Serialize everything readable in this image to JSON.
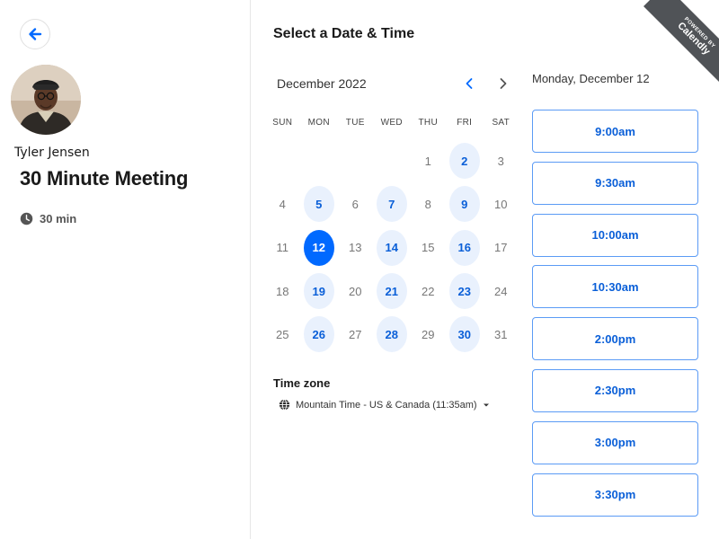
{
  "host": {
    "name": "Tyler Jensen"
  },
  "event": {
    "title": "30 Minute Meeting",
    "duration": "30 min"
  },
  "calendar": {
    "section_title": "Select a Date & Time",
    "month": "December 2022",
    "weekdays": [
      "SUN",
      "MON",
      "TUE",
      "WED",
      "THU",
      "FRI",
      "SAT"
    ],
    "days": [
      {
        "num": "",
        "state": "empty"
      },
      {
        "num": "",
        "state": "empty"
      },
      {
        "num": "",
        "state": "empty"
      },
      {
        "num": "",
        "state": "empty"
      },
      {
        "num": "1",
        "state": "unavailable"
      },
      {
        "num": "2",
        "state": "available"
      },
      {
        "num": "3",
        "state": "unavailable"
      },
      {
        "num": "4",
        "state": "unavailable"
      },
      {
        "num": "5",
        "state": "available"
      },
      {
        "num": "6",
        "state": "unavailable"
      },
      {
        "num": "7",
        "state": "available"
      },
      {
        "num": "8",
        "state": "unavailable"
      },
      {
        "num": "9",
        "state": "available"
      },
      {
        "num": "10",
        "state": "unavailable"
      },
      {
        "num": "11",
        "state": "unavailable"
      },
      {
        "num": "12",
        "state": "selected"
      },
      {
        "num": "13",
        "state": "unavailable"
      },
      {
        "num": "14",
        "state": "available"
      },
      {
        "num": "15",
        "state": "unavailable"
      },
      {
        "num": "16",
        "state": "available"
      },
      {
        "num": "17",
        "state": "unavailable"
      },
      {
        "num": "18",
        "state": "unavailable"
      },
      {
        "num": "19",
        "state": "available"
      },
      {
        "num": "20",
        "state": "unavailable"
      },
      {
        "num": "21",
        "state": "available"
      },
      {
        "num": "22",
        "state": "unavailable"
      },
      {
        "num": "23",
        "state": "available"
      },
      {
        "num": "24",
        "state": "unavailable"
      },
      {
        "num": "25",
        "state": "unavailable"
      },
      {
        "num": "26",
        "state": "available"
      },
      {
        "num": "27",
        "state": "unavailable"
      },
      {
        "num": "28",
        "state": "available"
      },
      {
        "num": "29",
        "state": "unavailable"
      },
      {
        "num": "30",
        "state": "available"
      },
      {
        "num": "31",
        "state": "unavailable"
      }
    ]
  },
  "timezone": {
    "label": "Time zone",
    "value": "Mountain Time - US & Canada (11:35am)"
  },
  "times": {
    "selected_date": "Monday, December 12",
    "slots": [
      "9:00am",
      "9:30am",
      "10:00am",
      "10:30am",
      "2:00pm",
      "2:30pm",
      "3:00pm",
      "3:30pm"
    ]
  },
  "ribbon": {
    "powered": "POWERED BY",
    "brand": "Calendly"
  },
  "colors": {
    "accent": "#0069ff",
    "available_bg": "#e9f1fd",
    "link": "#0a5fd8",
    "ribbon": "#505357"
  },
  "icons": {
    "back": "arrow-left-icon",
    "clock": "clock-icon",
    "globe": "globe-icon",
    "prev": "chevron-left-icon",
    "next": "chevron-right-icon",
    "dropdown": "caret-down-icon"
  }
}
